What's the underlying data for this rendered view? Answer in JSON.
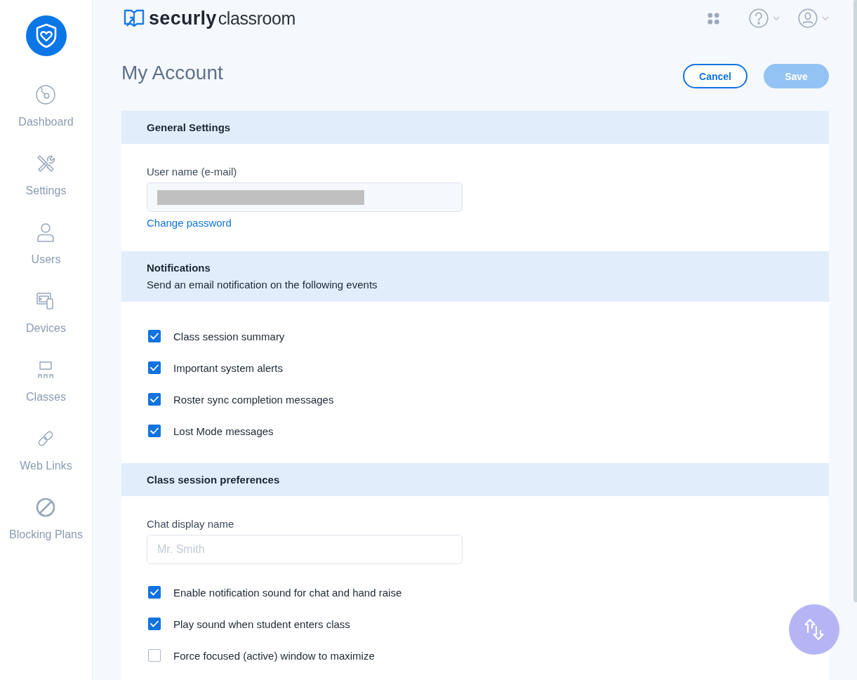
{
  "sidebar": {
    "items": [
      {
        "label": "Dashboard",
        "kind": "gauge",
        "selected": false
      },
      {
        "label": "Settings",
        "kind": "tools",
        "selected": false
      },
      {
        "label": "Users",
        "kind": "person",
        "selected": false
      },
      {
        "label": "Devices",
        "kind": "devices",
        "selected": false
      },
      {
        "label": "Classes",
        "kind": "classroom",
        "selected": false
      },
      {
        "label": "Web Links",
        "kind": "link",
        "selected": false
      },
      {
        "label": "Blocking Plans",
        "kind": "blocked",
        "selected": false
      }
    ]
  },
  "header": {
    "brand_name": "securly",
    "product_name": "classroom"
  },
  "page": {
    "title": "My Account",
    "buttons": [
      {
        "label": "Cancel",
        "kind": "secondary",
        "disabled": false
      },
      {
        "label": "Save",
        "kind": "primary",
        "disabled": true
      }
    ]
  },
  "sections": [
    {
      "title": "General Settings",
      "field": {
        "label": "User name (e-mail)",
        "redacted": true
      },
      "link": "Change password"
    },
    {
      "title": "Notifications",
      "subtitle": "Send an email notification on the following events",
      "options": [
        {
          "label": "Class session summary",
          "checked": true
        },
        {
          "label": "Important system alerts",
          "checked": true
        },
        {
          "label": "Roster sync completion messages",
          "checked": true
        },
        {
          "label": "Lost Mode messages",
          "checked": true
        }
      ]
    },
    {
      "title": "Class session preferences",
      "field": {
        "label": "Chat display name",
        "placeholder": "Mr. Smith"
      },
      "options": [
        {
          "label": "Enable notification sound for chat and hand raise",
          "checked": true
        },
        {
          "label": "Play sound when student enters class",
          "checked": true
        },
        {
          "label": "Force focused (active) window to maximize",
          "checked": false
        }
      ]
    }
  ]
}
